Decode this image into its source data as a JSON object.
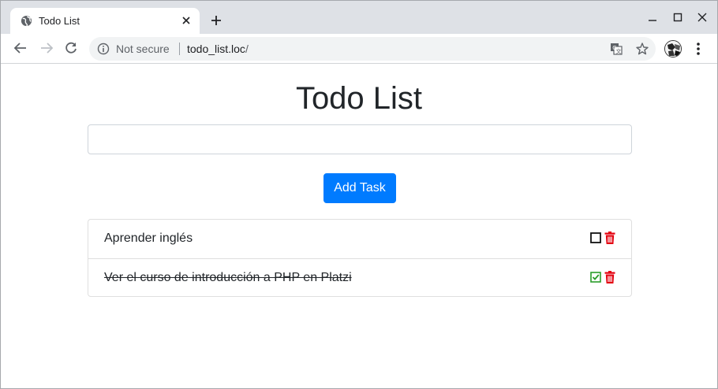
{
  "browser": {
    "tab_title": "Todo List",
    "security_label": "Not secure",
    "url_host": "todo_list.loc",
    "url_path": "/"
  },
  "icons": {
    "tab": "globe-icon",
    "toolbar": [
      "back-icon",
      "forward-icon",
      "reload-icon",
      "info-icon",
      "translate-icon",
      "star-icon",
      "menu-icon"
    ]
  },
  "page": {
    "title": "Todo List",
    "input_value": "",
    "add_button_label": "Add Task"
  },
  "tasks": [
    {
      "text": "Aprender inglés",
      "completed": false
    },
    {
      "text": "Ver el curso de introducción a PHP en Platzi",
      "completed": true
    }
  ],
  "colors": {
    "primary": "#007bff",
    "delete": "#e3000f",
    "done_check": "#2a9d2a"
  }
}
